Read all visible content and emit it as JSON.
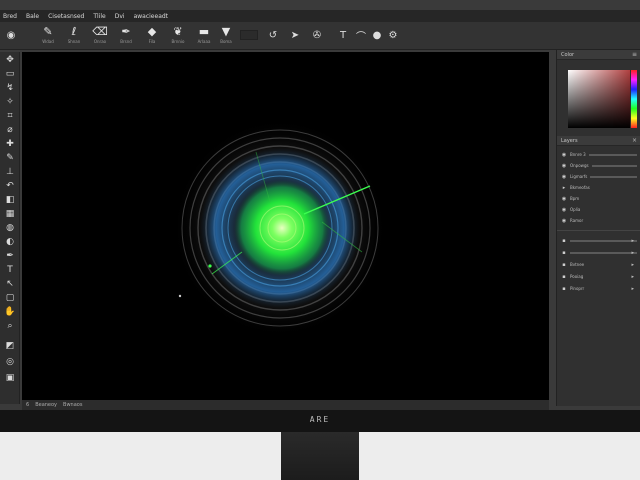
{
  "menu": {
    "app_name": "Bred",
    "items": [
      "Bale",
      "Cisetasnsed",
      "Tlile",
      "Dvi",
      "awacieeadt"
    ]
  },
  "options": {
    "tools": [
      {
        "icon": "brush",
        "label": "Wdad"
      },
      {
        "icon": "lasso",
        "label": "Shnan"
      },
      {
        "icon": "eraser",
        "label": "Onrao"
      },
      {
        "icon": "pen",
        "label": "Brsnd"
      },
      {
        "icon": "bucket",
        "label": "Fila"
      },
      {
        "icon": "clone",
        "label": "Brnnio"
      },
      {
        "icon": "line",
        "label": "Arlaaa"
      },
      {
        "icon": "shield",
        "label": "Boma"
      }
    ]
  },
  "tools": [
    "move",
    "marquee",
    "lasso",
    "wand",
    "crop",
    "eyedropper",
    "heal",
    "brush",
    "stamp",
    "history",
    "eraser",
    "gradient",
    "blur",
    "dodge",
    "pen",
    "type",
    "path",
    "shape",
    "hand",
    "zoom",
    "fg-bg",
    "mask",
    "screen"
  ],
  "panels": {
    "color_title": "Color",
    "swatches_title": "Layers",
    "layers": [
      {
        "name": "Bnnre 3"
      },
      {
        "name": "Onpowgs"
      },
      {
        "name": "Ligmarfs"
      },
      {
        "name": "Bkmeofas"
      },
      {
        "name": "Bpm"
      },
      {
        "name": "Oplia"
      },
      {
        "name": "Ramor"
      }
    ],
    "lower_rows": [
      {
        "name": "Bvtnee"
      },
      {
        "name": "Pooiag"
      },
      {
        "name": "Pinoprr"
      }
    ]
  },
  "status": {
    "zoom": "6",
    "doc_label": "Beaneoy",
    "extra": "Bwnaos"
  },
  "bezel": {
    "logo": "ARE"
  },
  "colors": {
    "glow_core": "#c8ff80",
    "glow_green": "#22e33a",
    "glow_blue": "#1f6fb8",
    "ring_gray": "#6e6e6e"
  }
}
